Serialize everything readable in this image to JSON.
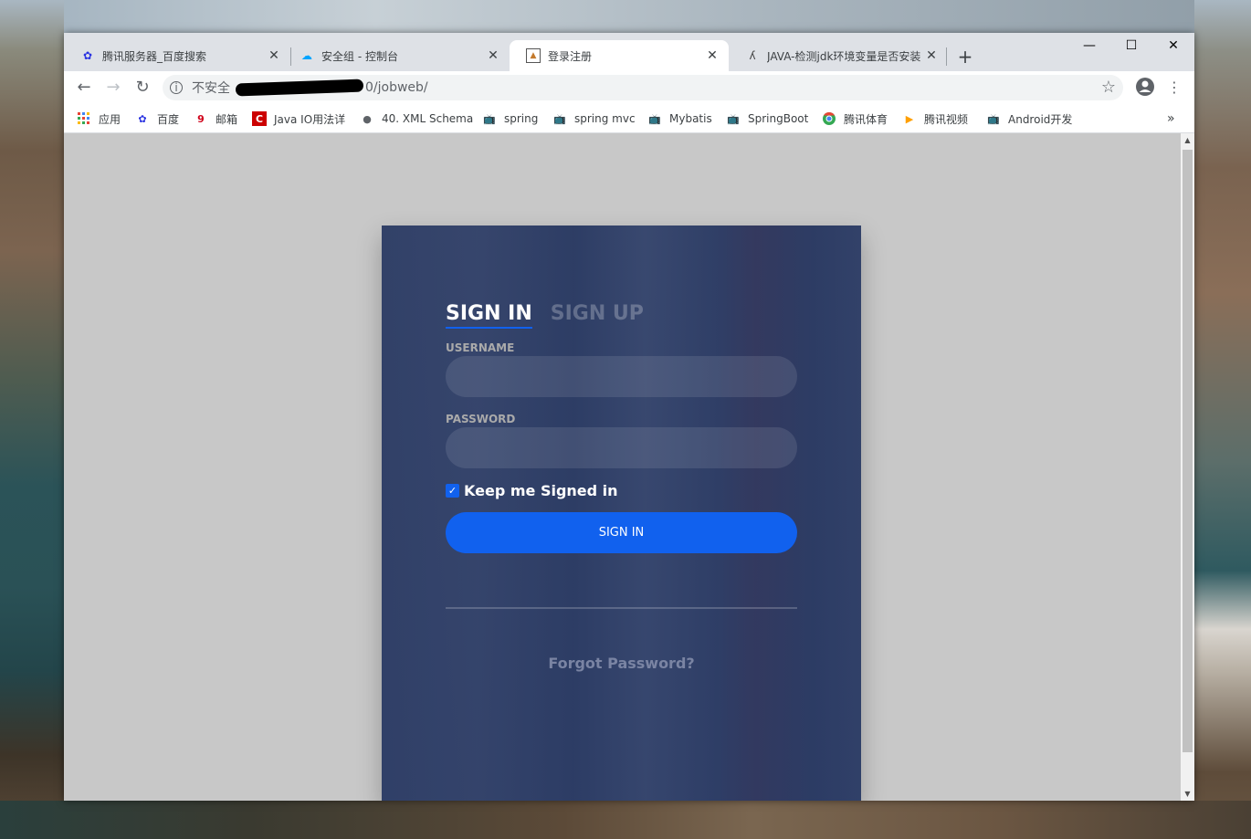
{
  "browser": {
    "tabs": [
      {
        "label": "腾讯服务器_百度搜索",
        "icon": "baidu-paw-icon"
      },
      {
        "label": "安全组 - 控制台",
        "icon": "cloud-icon"
      },
      {
        "label": "登录注册",
        "icon": "image-icon"
      },
      {
        "label": "JAVA-检测jdk环境变量是否安装",
        "icon": "feather-icon"
      }
    ],
    "new_tab": "+",
    "window_controls": {
      "minimize": "—",
      "maximize": "☐",
      "close": "✕"
    },
    "address": {
      "insecure_label": "不安全",
      "path": "0/jobweb/"
    },
    "bookmarks": [
      {
        "label": "应用",
        "icon": "apps-grid-icon"
      },
      {
        "label": "百度",
        "icon": "baidu-paw-icon"
      },
      {
        "label": "邮箱",
        "icon": "mail-icon"
      },
      {
        "label": "Java IO用法详",
        "icon": "c-logo-icon"
      },
      {
        "label": "40. XML Schema",
        "icon": "globe-icon"
      },
      {
        "label": "spring",
        "icon": "bilibili-icon"
      },
      {
        "label": "spring mvc",
        "icon": "bilibili-icon"
      },
      {
        "label": "Mybatis",
        "icon": "bilibili-icon"
      },
      {
        "label": "SpringBoot",
        "icon": "bilibili-icon"
      },
      {
        "label": "腾讯体育",
        "icon": "chrome-icon"
      },
      {
        "label": "腾讯视频",
        "icon": "play-icon"
      },
      {
        "label": "Android开发",
        "icon": "bilibili-icon"
      }
    ],
    "bookmarks_overflow": "»"
  },
  "login": {
    "tab_signin": "SIGN IN",
    "tab_signup": "SIGN UP",
    "username_label": "USERNAME",
    "username_value": "",
    "password_label": "PASSWORD",
    "password_value": "",
    "keep_signed_in": "Keep me Signed in",
    "keep_signed_in_checked": true,
    "submit_label": "SIGN IN",
    "forgot_password": "Forgot Password?"
  },
  "colors": {
    "accent": "#1161ee",
    "card_overlay": "#28396a",
    "page_bg": "#c8c8c8"
  }
}
